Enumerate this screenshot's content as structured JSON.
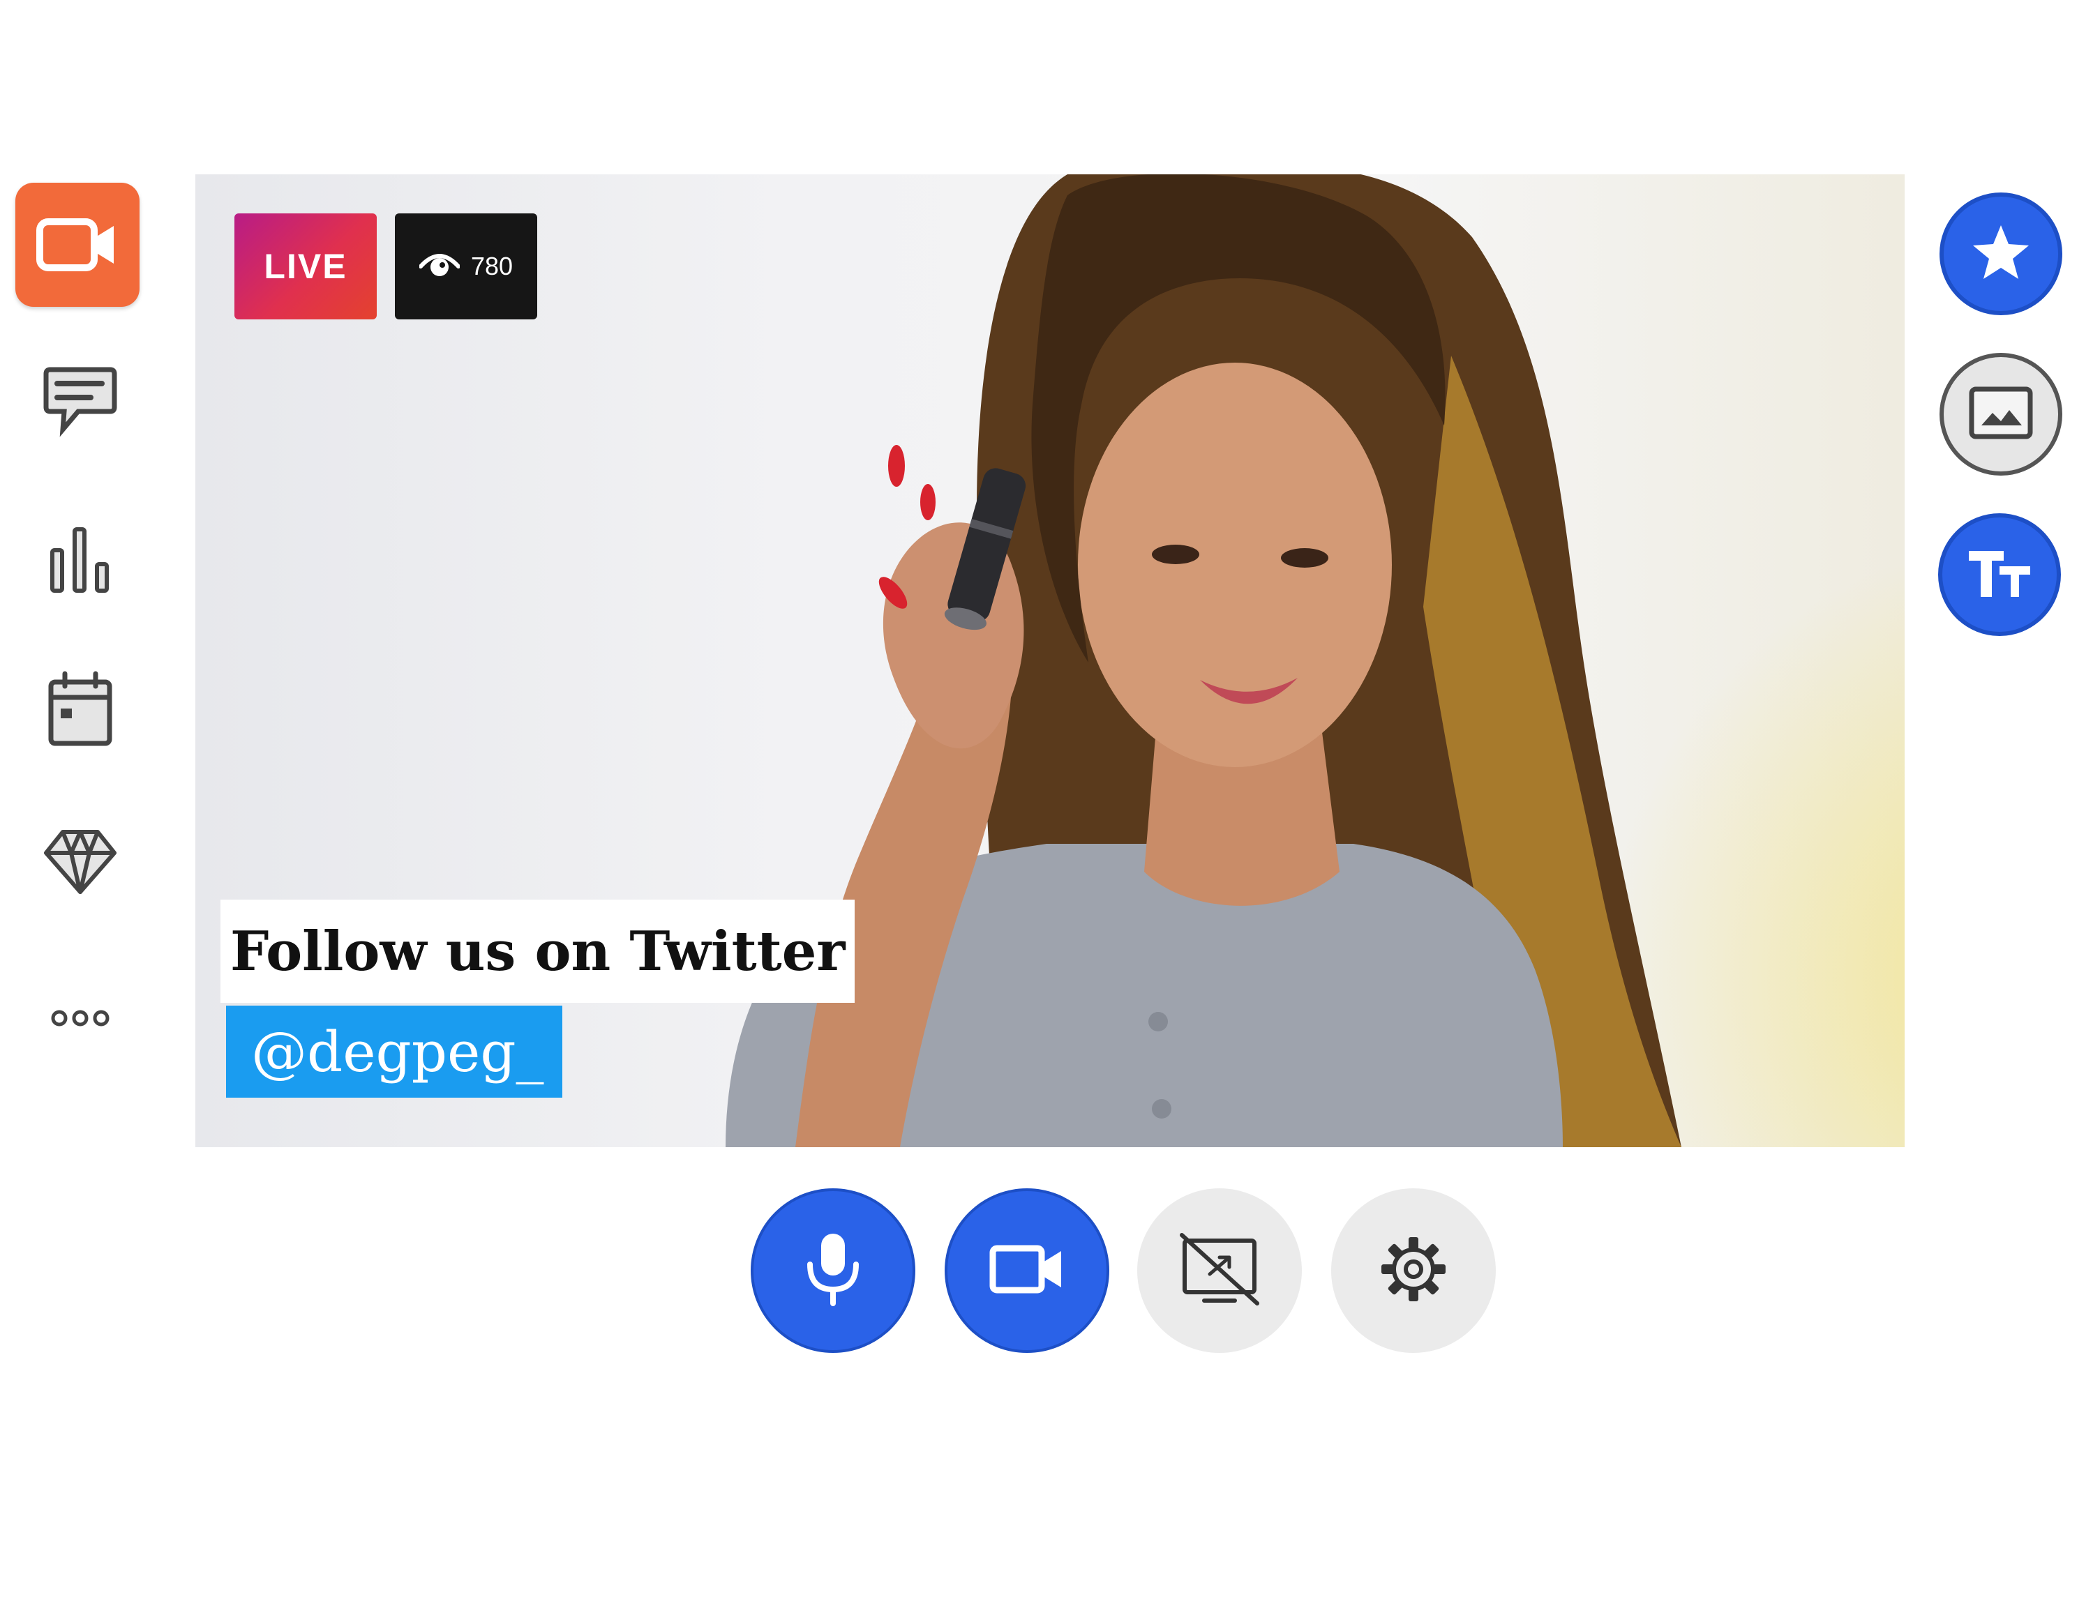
{
  "sidebar": {
    "items": [
      {
        "name": "camera",
        "icon": "video-camera-icon",
        "active": true
      },
      {
        "name": "chat",
        "icon": "chat-bubble-icon"
      },
      {
        "name": "stats",
        "icon": "bar-chart-icon"
      },
      {
        "name": "calendar",
        "icon": "calendar-icon"
      },
      {
        "name": "diamond",
        "icon": "diamond-icon"
      },
      {
        "name": "more",
        "icon": "more-dots-icon"
      }
    ],
    "active_color": "#f26a3a"
  },
  "stream": {
    "live_label": "LIVE",
    "viewer_count": "780",
    "overlay": {
      "title": "Follow us on Twitter",
      "handle": "@degpeg_"
    }
  },
  "tools": [
    {
      "name": "star",
      "icon": "star-icon"
    },
    {
      "name": "image",
      "icon": "image-icon"
    },
    {
      "name": "text",
      "icon": "text-size-icon"
    }
  ],
  "controls": [
    {
      "name": "microphone",
      "icon": "microphone-icon",
      "active": true
    },
    {
      "name": "camera",
      "icon": "video-camera-icon",
      "active": true
    },
    {
      "name": "screen-share",
      "icon": "screen-share-off-icon",
      "active": false
    },
    {
      "name": "settings",
      "icon": "gear-icon",
      "active": false
    }
  ],
  "colors": {
    "accent_blue": "#2a62e8",
    "twitter_blue": "#1a9cf0",
    "sidebar_active": "#f26a3a"
  }
}
